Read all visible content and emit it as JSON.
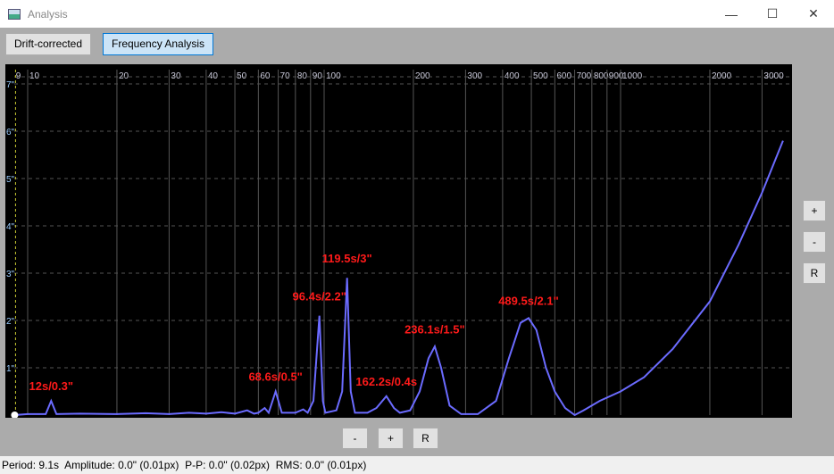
{
  "window": {
    "title": "Analysis",
    "minimize": "—",
    "maximize": "☐",
    "close": "✕"
  },
  "toolbar": {
    "tab1": "Drift-corrected",
    "tab2": "Frequency Analysis"
  },
  "side_buttons": {
    "plus": "+",
    "minus": "-",
    "reset": "R"
  },
  "bottom_buttons": {
    "minus": "-",
    "plus": "+",
    "reset": "R"
  },
  "status": {
    "period": "Period: 9.1s",
    "amplitude": "Amplitude: 0.0\" (0.01px)",
    "pp": "P-P: 0.0\" (0.02px)",
    "rms": "RMS: 0.0\" (0.01px)"
  },
  "chart_data": {
    "type": "line",
    "xscale": "log",
    "xlim": [
      8.9,
      3600
    ],
    "ylim": [
      0,
      7.2
    ],
    "x_ticks": [
      9,
      10,
      20,
      30,
      40,
      50,
      60,
      70,
      80,
      90,
      100,
      200,
      300,
      400,
      500,
      600,
      700,
      800,
      900,
      1000,
      2000,
      3000
    ],
    "y_ticks": [
      "1\"",
      "2\"",
      "3\"",
      "4\"",
      "5\"",
      "6\"",
      "7\""
    ],
    "y_tick_values": [
      1,
      2,
      3,
      4,
      5,
      6,
      7
    ],
    "cursor_period": 9.1,
    "line_color": "#6b6bff",
    "label_color": "#ff1a1a",
    "annotations": [
      {
        "text": "12s/0.3\"",
        "x": 12,
        "y": 0.3
      },
      {
        "text": "68.6s/0.5\"",
        "x": 68.6,
        "y": 0.5
      },
      {
        "text": "96.4s/2.2\"",
        "x": 96.4,
        "y": 2.2
      },
      {
        "text": "119.5s/3\"",
        "x": 119.5,
        "y": 3
      },
      {
        "text": "162.2s/0.4s",
        "x": 162.2,
        "y": 0.4
      },
      {
        "text": "236.1s/1.5\"",
        "x": 236.1,
        "y": 1.5
      },
      {
        "text": "489.5s/2.1\"",
        "x": 489.5,
        "y": 2.1
      }
    ],
    "series": [
      {
        "name": "amplitude",
        "points": [
          [
            9,
            0
          ],
          [
            10,
            0.02
          ],
          [
            11.5,
            0.02
          ],
          [
            12,
            0.3
          ],
          [
            12.5,
            0.02
          ],
          [
            15,
            0.03
          ],
          [
            20,
            0.02
          ],
          [
            25,
            0.04
          ],
          [
            30,
            0.02
          ],
          [
            35,
            0.05
          ],
          [
            40,
            0.03
          ],
          [
            45,
            0.06
          ],
          [
            50,
            0.03
          ],
          [
            55,
            0.1
          ],
          [
            58,
            0.03
          ],
          [
            60,
            0.05
          ],
          [
            63,
            0.15
          ],
          [
            65,
            0.05
          ],
          [
            68.6,
            0.5
          ],
          [
            72,
            0.05
          ],
          [
            80,
            0.05
          ],
          [
            85,
            0.12
          ],
          [
            88,
            0.05
          ],
          [
            92,
            0.3
          ],
          [
            96.4,
            2.1
          ],
          [
            99,
            0.3
          ],
          [
            101,
            0.05
          ],
          [
            110,
            0.1
          ],
          [
            115,
            0.5
          ],
          [
            119.5,
            2.9
          ],
          [
            123,
            0.5
          ],
          [
            127,
            0.05
          ],
          [
            140,
            0.05
          ],
          [
            150,
            0.15
          ],
          [
            162.2,
            0.4
          ],
          [
            172,
            0.15
          ],
          [
            180,
            0.05
          ],
          [
            195,
            0.1
          ],
          [
            210,
            0.5
          ],
          [
            225,
            1.2
          ],
          [
            236.1,
            1.45
          ],
          [
            248,
            1.0
          ],
          [
            265,
            0.2
          ],
          [
            290,
            0.02
          ],
          [
            330,
            0.02
          ],
          [
            380,
            0.3
          ],
          [
            420,
            1.2
          ],
          [
            460,
            1.95
          ],
          [
            489.5,
            2.05
          ],
          [
            520,
            1.8
          ],
          [
            560,
            1.0
          ],
          [
            600,
            0.5
          ],
          [
            650,
            0.15
          ],
          [
            700,
            0.0
          ],
          [
            750,
            0.1
          ],
          [
            850,
            0.3
          ],
          [
            1000,
            0.5
          ],
          [
            1200,
            0.8
          ],
          [
            1500,
            1.4
          ],
          [
            2000,
            2.4
          ],
          [
            2500,
            3.6
          ],
          [
            3000,
            4.7
          ],
          [
            3530,
            5.8
          ]
        ]
      }
    ]
  }
}
